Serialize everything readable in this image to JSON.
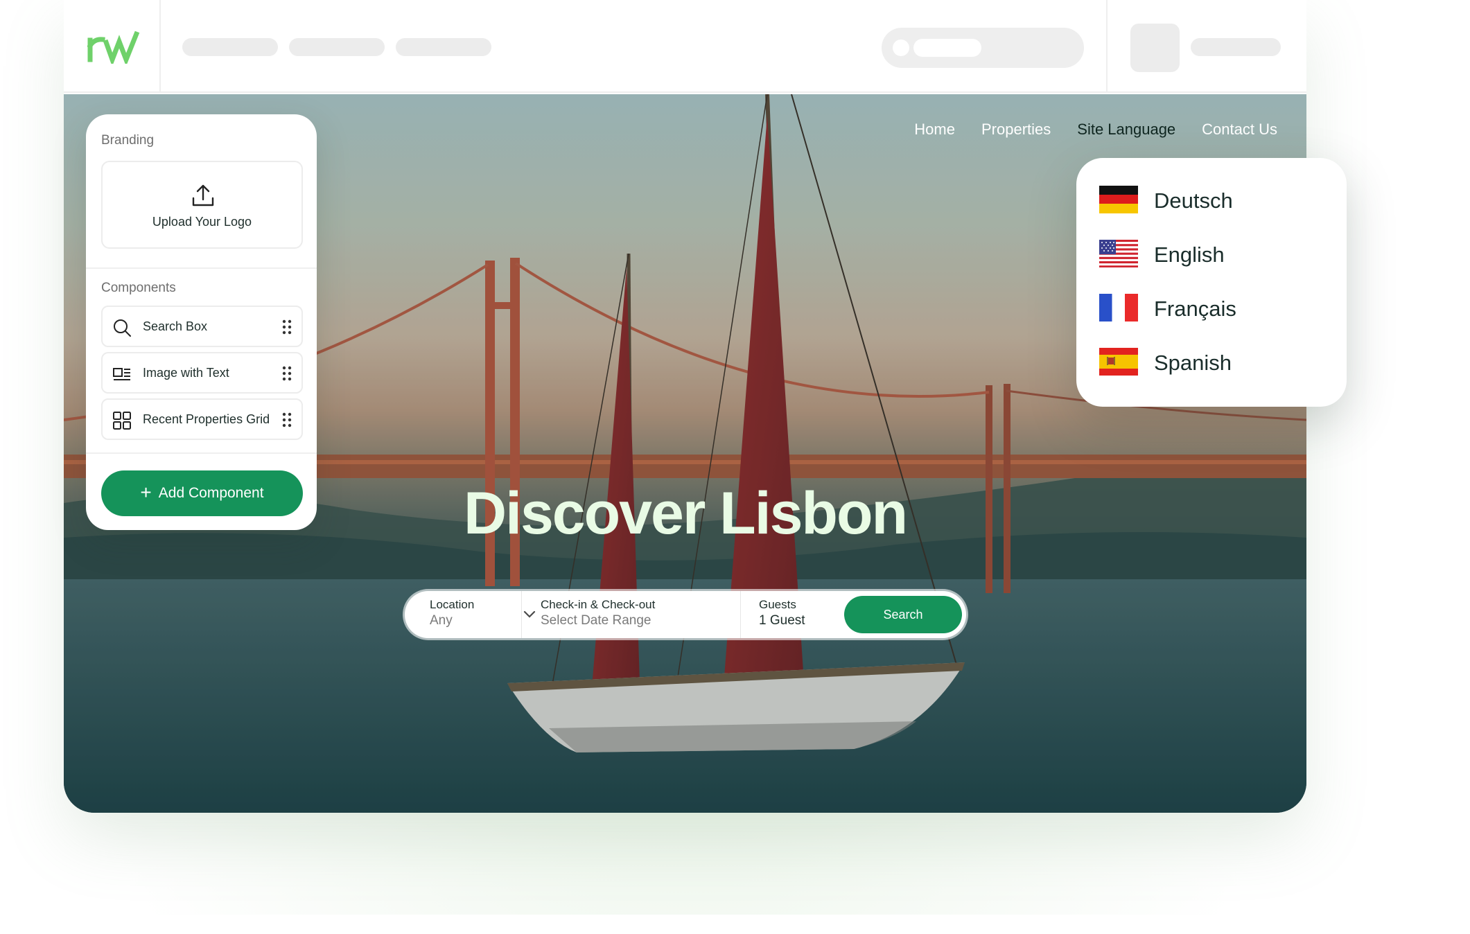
{
  "colors": {
    "brand_green": "#15935a",
    "logo_green": "#6fd16a",
    "hero_title": "#e9fbe5",
    "panel_bg": "#ffffff"
  },
  "topbar": {
    "logo_icon": "rw-logo-icon",
    "placeholders": [
      "nav-skeleton",
      "nav-skeleton",
      "nav-skeleton",
      "search-skeleton",
      "avatar-skeleton",
      "user-skeleton"
    ]
  },
  "hero": {
    "nav": {
      "home": "Home",
      "properties": "Properties",
      "site_language": "Site Language",
      "contact": "Contact Us"
    },
    "title": "Discover Lisbon",
    "search": {
      "location_label": "Location",
      "location_value": "Any",
      "dates_label": "Check-in & Check-out",
      "dates_placeholder": "Select Date Range",
      "guests_label": "Guests",
      "guests_value": "1 Guest",
      "button": "Search"
    }
  },
  "panel": {
    "branding_title": "Branding",
    "upload_label": "Upload Your Logo",
    "components_title": "Components",
    "components": [
      {
        "label": "Search Box",
        "icon": "search-icon"
      },
      {
        "label": "Image with Text",
        "icon": "image-text-icon"
      },
      {
        "label": "Recent Properties Grid",
        "icon": "grid-icon"
      }
    ],
    "add_button": "Add Component"
  },
  "languages": [
    {
      "label": "Deutsch",
      "flag": "germany-flag-icon"
    },
    {
      "label": "English",
      "flag": "usa-flag-icon"
    },
    {
      "label": "Français",
      "flag": "france-flag-icon"
    },
    {
      "label": "Spanish",
      "flag": "spain-flag-icon"
    }
  ]
}
